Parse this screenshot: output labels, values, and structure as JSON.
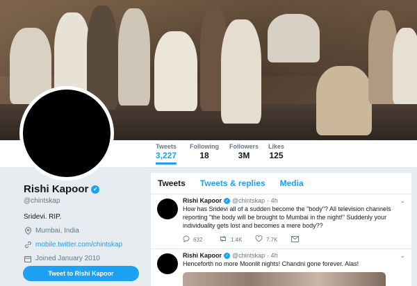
{
  "profile": {
    "name": "Rishi Kapoor",
    "handle": "@chintskap",
    "bio": "Sridevi. RIP.",
    "location": "Mumbai, India",
    "website": "mobile.twitter.com/chintskap",
    "joined": "Joined January 2010",
    "tweet_to_label": "Tweet to Rishi Kapoor"
  },
  "stats": [
    {
      "label": "Tweets",
      "value": "3,227"
    },
    {
      "label": "Following",
      "value": "18"
    },
    {
      "label": "Followers",
      "value": "3M"
    },
    {
      "label": "Likes",
      "value": "125"
    }
  ],
  "tabs": [
    "Tweets",
    "Tweets & replies",
    "Media"
  ],
  "tweets": [
    {
      "name": "Rishi Kapoor",
      "handle": "@chintskap",
      "time": "· 4h",
      "text": "How has Sridevi all of a sudden become the \"body\"? All television channels reporting  \"the body will be brought to Mumbai in the night!\" Suddenly your individuality gets lost and becomes a mere body??",
      "replies": "632",
      "retweets": "1.4K",
      "likes": "7.7K"
    },
    {
      "name": "Rishi Kapoor",
      "handle": "@chintskap",
      "time": "· 4h",
      "text": "Henceforth no more Moonlit nights! Chandni gone forever. Alas!"
    }
  ],
  "colors": {
    "accent": "#1da1f2",
    "background": "#e6ecf0",
    "text": "#14171a",
    "muted": "#657786"
  },
  "icons": [
    "verified-badge-icon",
    "location-pin-icon",
    "link-icon",
    "calendar-icon",
    "reply-icon",
    "retweet-icon",
    "heart-icon",
    "message-icon",
    "chevron-down-icon"
  ]
}
